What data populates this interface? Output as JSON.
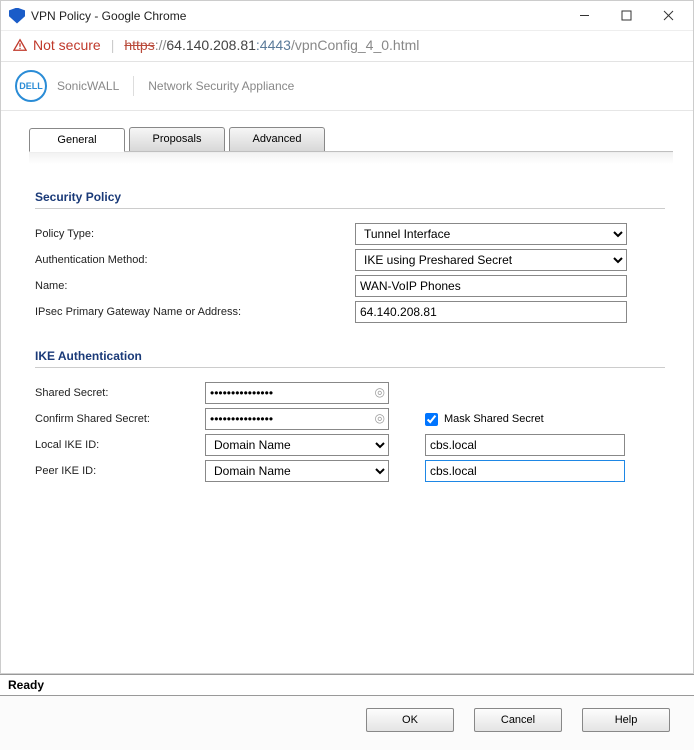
{
  "window": {
    "title": "VPN Policy - Google Chrome"
  },
  "address": {
    "not_secure": "Not secure",
    "scheme": "https",
    "sep": "://",
    "host": "64.140.208.81",
    "port": ":4443",
    "path": "/vpnConfig_4_0.html"
  },
  "brand": {
    "logo": "DELL",
    "product": "SonicWALL",
    "subtitle": "Network Security Appliance"
  },
  "tabs": [
    "General",
    "Proposals",
    "Advanced"
  ],
  "sections": {
    "policy": {
      "title": "Security Policy",
      "policy_type_label": "Policy Type:",
      "policy_type_value": "Tunnel Interface",
      "auth_method_label": "Authentication Method:",
      "auth_method_value": "IKE using Preshared Secret",
      "name_label": "Name:",
      "name_value": "WAN-VoIP Phones",
      "gateway_label": "IPsec Primary Gateway Name or Address:",
      "gateway_value": "64.140.208.81"
    },
    "ike": {
      "title": "IKE Authentication",
      "shared_secret_label": "Shared Secret:",
      "shared_secret_value": "•••••••••••••••",
      "confirm_secret_label": "Confirm Shared Secret:",
      "confirm_secret_value": "•••••••••••••••",
      "mask_label": "Mask Shared Secret",
      "local_id_label": "Local IKE ID:",
      "local_id_type": "Domain Name",
      "local_id_value": "cbs.local",
      "peer_id_label": "Peer IKE ID:",
      "peer_id_type": "Domain Name",
      "peer_id_value": "cbs.local"
    }
  },
  "footer": {
    "status": "Ready",
    "ok": "OK",
    "cancel": "Cancel",
    "help": "Help"
  }
}
